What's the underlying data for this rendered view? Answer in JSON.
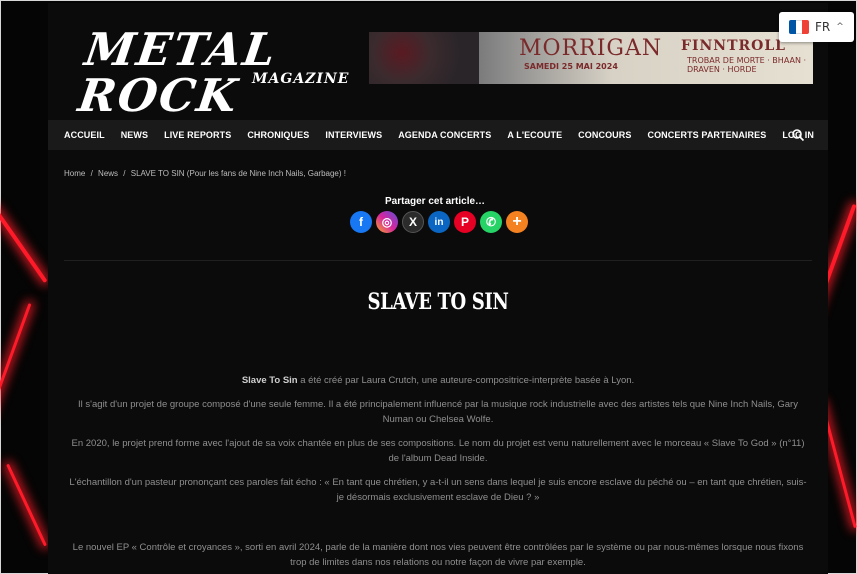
{
  "logo": {
    "main": "METAL ROCK",
    "sub": "MAGAZINE"
  },
  "banner": {
    "headline": "MORRIGAN",
    "date": "SAMEDI 25 MAI 2024",
    "band": "FINNTROLL",
    "lineup": "TROBAR DE MORTE · BHAAN · DRAVEN · HORDE"
  },
  "language": {
    "code": "FR",
    "flag_colors": [
      "#0055a4",
      "#ffffff",
      "#ef4135"
    ]
  },
  "nav": {
    "items": [
      "ACCUEIL",
      "NEWS",
      "LIVE REPORTS",
      "CHRONIQUES",
      "INTERVIEWS",
      "AGENDA CONCERTS",
      "A L'ECOUTE",
      "CONCOURS",
      "CONCERTS PARTENAIRES",
      "LOG IN"
    ]
  },
  "breadcrumb": {
    "home": "Home",
    "sep1": "/",
    "section": "News",
    "sep2": "/",
    "current": "SLAVE TO SIN (Pour les fans de Nine Inch Nails, Garbage) !"
  },
  "share": {
    "title": "Partager cet article…",
    "buttons": [
      {
        "name": "facebook",
        "glyph": "f",
        "color": "#1877f2"
      },
      {
        "name": "instagram",
        "glyph": "◎",
        "color": "#d6249f"
      },
      {
        "name": "x",
        "glyph": "X",
        "color": "#2b2b2b"
      },
      {
        "name": "linkedin",
        "glyph": "in",
        "color": "#0a66c2"
      },
      {
        "name": "pinterest",
        "glyph": "P",
        "color": "#e60023"
      },
      {
        "name": "whatsapp",
        "glyph": "✆",
        "color": "#25d366"
      },
      {
        "name": "more",
        "glyph": "+",
        "color": "#f58220"
      }
    ]
  },
  "article": {
    "title": "SLAVE TO SIN",
    "p1_bold": "Slave To Sin",
    "p1_rest": " a été créé par Laura Crutch, une auteure-compositrice-interprète basée à Lyon.",
    "p2": "Il s'agit d'un projet de groupe composé d'une seule femme. Il a été principalement influencé par la musique rock industrielle avec des artistes tels que Nine Inch Nails, Gary Numan ou Chelsea Wolfe.",
    "p3": "En 2020, le projet prend forme avec l'ajout de sa voix chantée en plus de ses compositions. Le nom du projet est venu naturellement avec le morceau « Slave To God » (n°11) de l'album Dead Inside.",
    "p4": "L'échantillon d'un pasteur prononçant ces paroles fait écho : « En tant que chrétien, y a-t-il un sens dans lequel je suis encore esclave du péché ou – en tant que chrétien, suis-je désormais exclusivement esclave de Dieu ? »",
    "p5": "Le nouvel EP « Contrôle et croyances », sorti en avril 2024, parle de la manière dont nos vies peuvent être contrôlées par le système ou par nous-mêmes lorsque nous fixons trop de limites dans nos relations ou notre façon de vivre par exemple."
  }
}
